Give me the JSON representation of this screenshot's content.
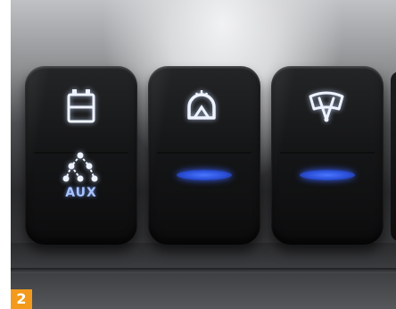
{
  "photo": {
    "figure_number": "2"
  },
  "switches": [
    {
      "icon": "battery-icon",
      "secondary_icon": "aux-network-icon",
      "label": "AUX"
    },
    {
      "icon": "light-dome-icon",
      "indicator_color": "#3a63f0"
    },
    {
      "icon": "wiper-icon",
      "indicator_color": "#3a63f0"
    }
  ],
  "colors": {
    "icon_glow": "#e8eeff",
    "aux_text": "#a9c3ff",
    "badge": "#f39a1c"
  }
}
